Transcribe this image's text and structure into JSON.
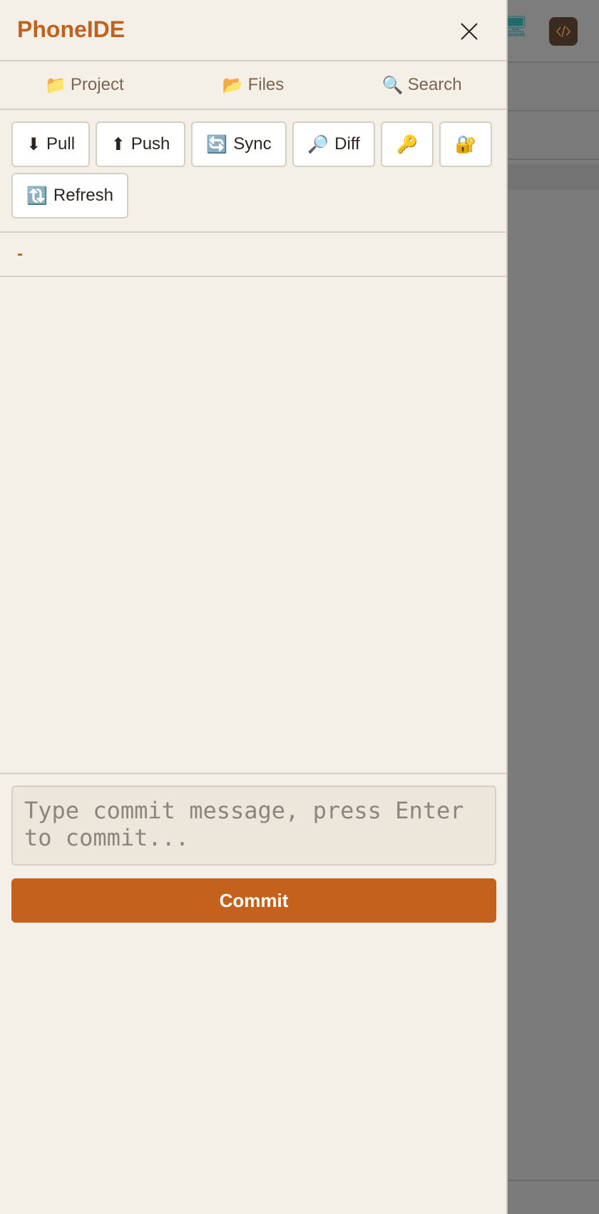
{
  "app": {
    "title": "PhoneIDE"
  },
  "nav_tabs": [
    {
      "icon": "📁",
      "icon_name": "folder-icon",
      "label": "Project"
    },
    {
      "icon": "📂",
      "icon_name": "open-folder-icon",
      "label": "Files"
    },
    {
      "icon": "🔍",
      "icon_name": "search-icon",
      "label": "Search"
    }
  ],
  "actions": {
    "pull": {
      "icon": "⬇",
      "label": "Pull"
    },
    "push": {
      "icon": "⬆",
      "label": "Push"
    },
    "sync": {
      "icon": "🔄",
      "label": "Sync"
    },
    "diff": {
      "icon": "🔎",
      "label": "Diff"
    },
    "key": {
      "icon": "🔑"
    },
    "lock": {
      "icon": "🔐"
    },
    "refresh": {
      "icon": "🔃",
      "label": "Refresh"
    }
  },
  "branch": {
    "name": "-"
  },
  "commit": {
    "placeholder": "Type commit message, press Enter to commit...",
    "button_label": "Commit"
  },
  "background": {
    "monitor_icon": "🖥"
  },
  "colors": {
    "accent": "#c4611c",
    "drawer_bg": "#f4efe7",
    "overlay": "#7b7b7b"
  }
}
